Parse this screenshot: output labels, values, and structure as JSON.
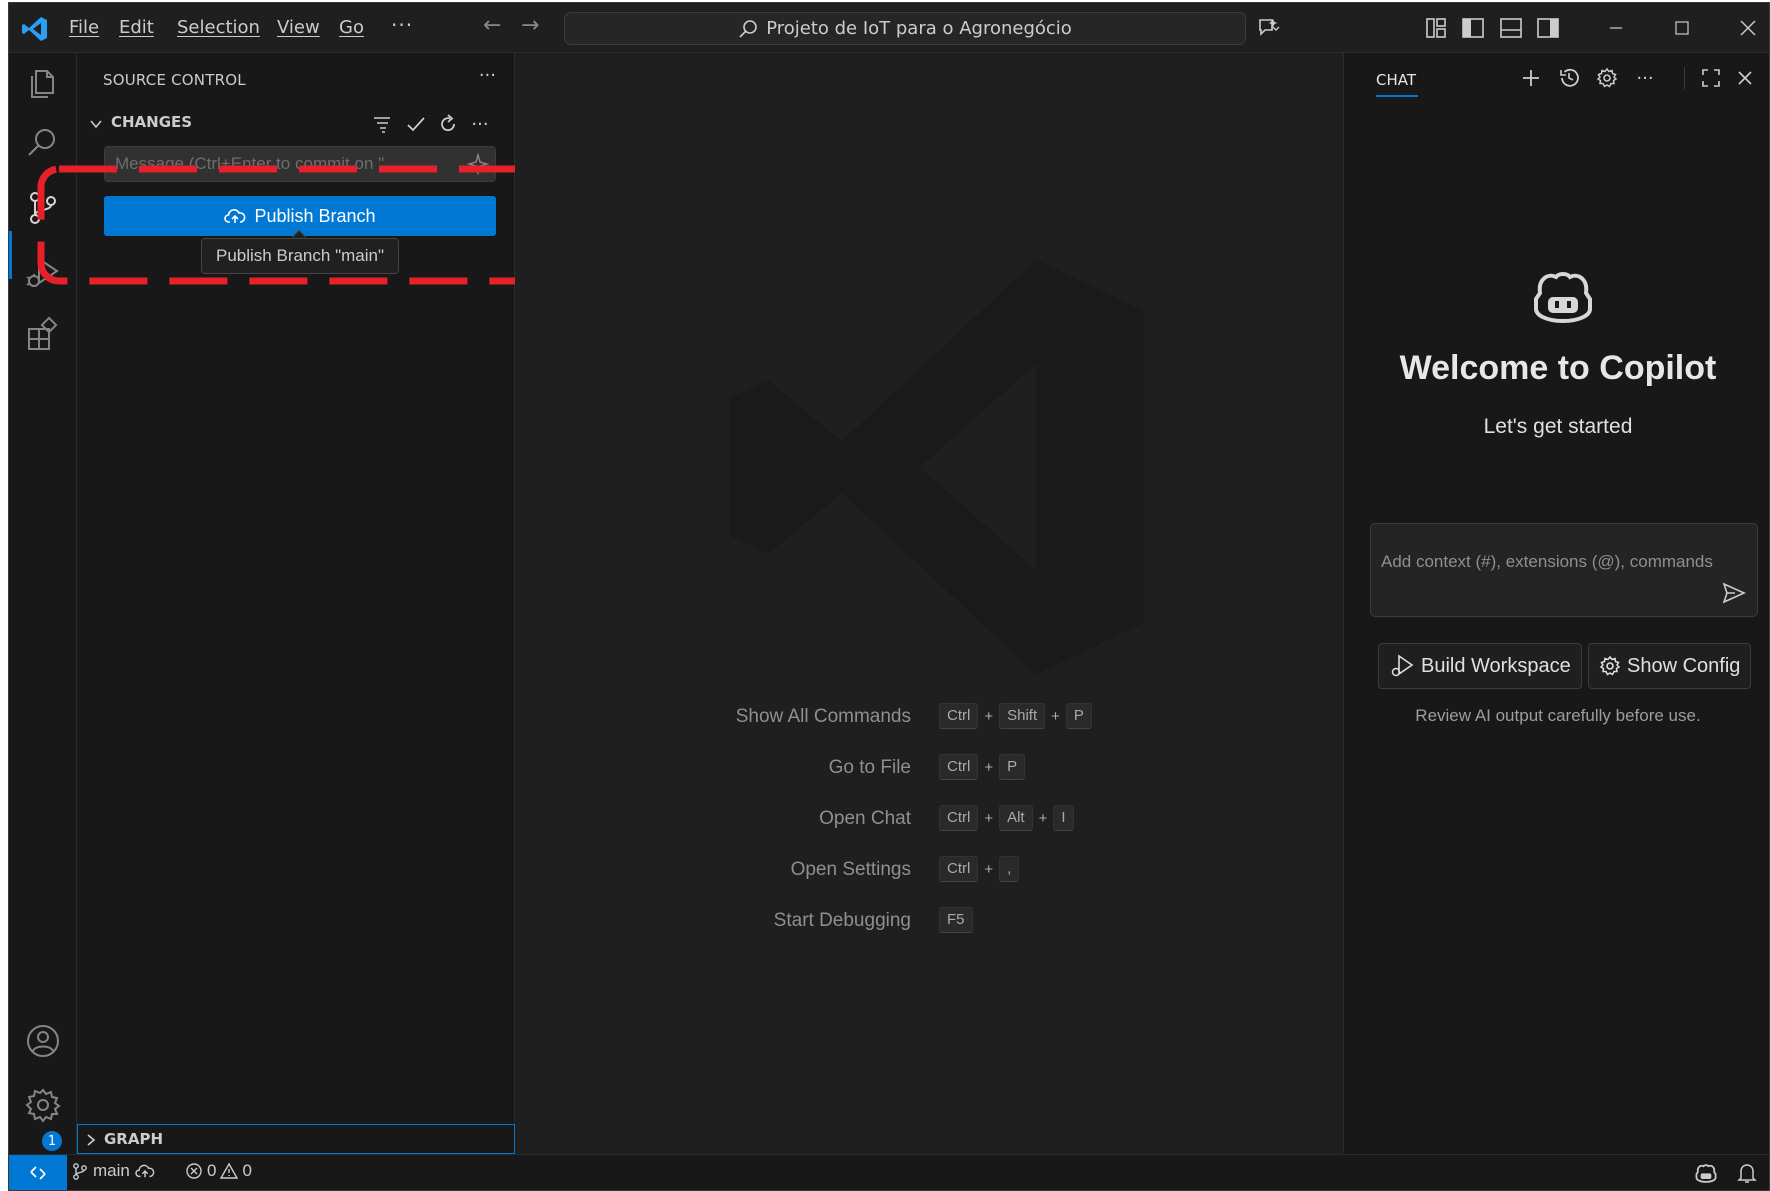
{
  "titlebar": {
    "menu": [
      "File",
      "Edit",
      "Selection",
      "View",
      "Go"
    ],
    "menu_more": "···",
    "command_center": "Projeto de IoT para o Agronegócio"
  },
  "sidebar": {
    "title": "SOURCE CONTROL",
    "more": "···",
    "changes_title": "CHANGES",
    "commit_placeholder": "Message (Ctrl+Enter to commit on \"...",
    "publish_label": "Publish Branch",
    "tooltip": "Publish Branch \"main\"",
    "graph_title": "GRAPH",
    "settings_badge": "1"
  },
  "editor": {
    "shortcuts": [
      {
        "label": "Show All Commands",
        "keys": [
          "Ctrl",
          "Shift",
          "P"
        ]
      },
      {
        "label": "Go to File",
        "keys": [
          "Ctrl",
          "P"
        ]
      },
      {
        "label": "Open Chat",
        "keys": [
          "Ctrl",
          "Alt",
          "I"
        ]
      },
      {
        "label": "Open Settings",
        "keys": [
          "Ctrl",
          ","
        ]
      },
      {
        "label": "Start Debugging",
        "keys": [
          "F5"
        ]
      }
    ]
  },
  "chat": {
    "tab": "CHAT",
    "welcome": "Welcome to Copilot",
    "subtitle": "Let's get started",
    "input_placeholder": "Add context (#), extensions (@), commands",
    "build_workspace": "Build Workspace",
    "show_config": "Show Config",
    "review": "Review AI output carefully before use."
  },
  "statusbar": {
    "branch": "main",
    "errors": "0",
    "warnings": "0"
  },
  "colors": {
    "accent": "#0078d4",
    "annotation": "#e8202a"
  }
}
